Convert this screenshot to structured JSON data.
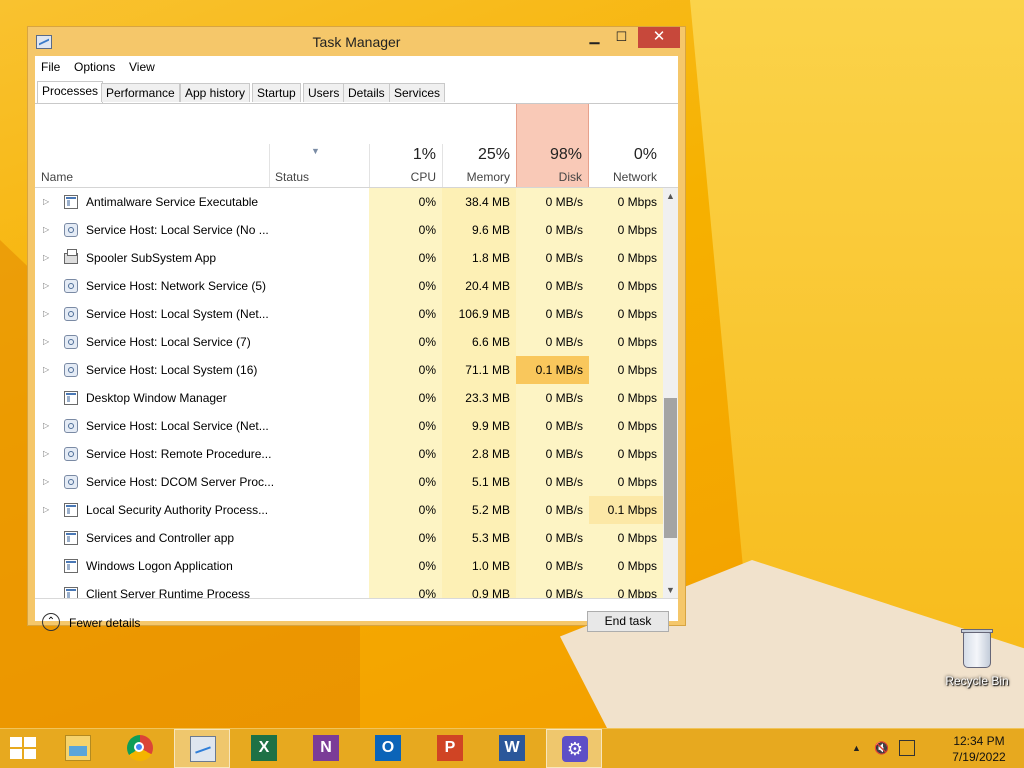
{
  "window": {
    "title": "Task Manager",
    "minimize_glyph": "▁",
    "maximize_glyph": "☐",
    "close_glyph": "✕"
  },
  "menu": [
    "File",
    "Options",
    "View"
  ],
  "tabs": [
    {
      "label": "Processes",
      "active": true
    },
    {
      "label": "Performance"
    },
    {
      "label": "App history"
    },
    {
      "label": "Startup"
    },
    {
      "label": "Users"
    },
    {
      "label": "Details"
    },
    {
      "label": "Services"
    }
  ],
  "columns": {
    "name": "Name",
    "status": "Status",
    "cpu": {
      "pct": "1%",
      "label": "CPU"
    },
    "memory": {
      "pct": "25%",
      "label": "Memory"
    },
    "disk": {
      "pct": "98%",
      "label": "Disk"
    },
    "network": {
      "pct": "0%",
      "label": "Network"
    }
  },
  "colors": {
    "disk_header_bg": "#f9c9b7",
    "heat_high": "#f9c75c",
    "heat_low": "#fdf4c4",
    "close_button": "#c7483b",
    "window_frame": "#f5c76a"
  },
  "processes": [
    {
      "name": "Antimalware Service Executable",
      "icon": "exe-icon",
      "expandable": true,
      "cpu": "0%",
      "memory": "38.4 MB",
      "disk": "0 MB/s",
      "network": "0 Mbps"
    },
    {
      "name": "Service Host: Local Service (No ...",
      "icon": "gear-icon",
      "expandable": true,
      "cpu": "0%",
      "memory": "9.6 MB",
      "disk": "0 MB/s",
      "network": "0 Mbps"
    },
    {
      "name": "Spooler SubSystem App",
      "icon": "printer-icon",
      "expandable": true,
      "cpu": "0%",
      "memory": "1.8 MB",
      "disk": "0 MB/s",
      "network": "0 Mbps"
    },
    {
      "name": "Service Host: Network Service (5)",
      "icon": "gear-icon",
      "expandable": true,
      "cpu": "0%",
      "memory": "20.4 MB",
      "disk": "0 MB/s",
      "network": "0 Mbps"
    },
    {
      "name": "Service Host: Local System (Net...",
      "icon": "gear-icon",
      "expandable": true,
      "cpu": "0%",
      "memory": "106.9 MB",
      "disk": "0 MB/s",
      "network": "0 Mbps"
    },
    {
      "name": "Service Host: Local Service (7)",
      "icon": "gear-icon",
      "expandable": true,
      "cpu": "0%",
      "memory": "6.6 MB",
      "disk": "0 MB/s",
      "network": "0 Mbps"
    },
    {
      "name": "Service Host: Local System (16)",
      "icon": "gear-icon",
      "expandable": true,
      "cpu": "0%",
      "memory": "71.1 MB",
      "disk": "0.1 MB/s",
      "network": "0 Mbps",
      "disk_hot": true
    },
    {
      "name": "Desktop Window Manager",
      "icon": "exe-icon",
      "expandable": false,
      "cpu": "0%",
      "memory": "23.3 MB",
      "disk": "0 MB/s",
      "network": "0 Mbps"
    },
    {
      "name": "Service Host: Local Service (Net...",
      "icon": "gear-icon",
      "expandable": true,
      "cpu": "0%",
      "memory": "9.9 MB",
      "disk": "0 MB/s",
      "network": "0 Mbps"
    },
    {
      "name": "Service Host: Remote Procedure...",
      "icon": "gear-icon",
      "expandable": true,
      "cpu": "0%",
      "memory": "2.8 MB",
      "disk": "0 MB/s",
      "network": "0 Mbps"
    },
    {
      "name": "Service Host: DCOM Server Proc...",
      "icon": "gear-icon",
      "expandable": true,
      "cpu": "0%",
      "memory": "5.1 MB",
      "disk": "0 MB/s",
      "network": "0 Mbps"
    },
    {
      "name": "Local Security Authority Process...",
      "icon": "exe-icon",
      "expandable": true,
      "cpu": "0%",
      "memory": "5.2 MB",
      "disk": "0 MB/s",
      "network": "0.1 Mbps",
      "net_warm": true
    },
    {
      "name": "Services and Controller app",
      "icon": "exe-icon",
      "expandable": false,
      "cpu": "0%",
      "memory": "5.3 MB",
      "disk": "0 MB/s",
      "network": "0 Mbps"
    },
    {
      "name": "Windows Logon Application",
      "icon": "exe-icon",
      "expandable": false,
      "cpu": "0%",
      "memory": "1.0 MB",
      "disk": "0 MB/s",
      "network": "0 Mbps"
    },
    {
      "name": "Client Server Runtime Process",
      "icon": "exe-icon",
      "expandable": false,
      "cpu": "0%",
      "memory": "0.9 MB",
      "disk": "0 MB/s",
      "network": "0 Mbps"
    }
  ],
  "footer": {
    "fewer_details": "Fewer details",
    "end_task": "End task"
  },
  "desktop": {
    "recycle_bin": "Recycle Bin"
  },
  "taskbar": {
    "apps": [
      {
        "name": "file-explorer",
        "icon": "folder-icon"
      },
      {
        "name": "chrome",
        "icon": "chrome-icon"
      },
      {
        "name": "task-manager",
        "icon": "task-manager-icon",
        "active": true
      },
      {
        "name": "excel",
        "icon": "excel-icon",
        "letter": "X"
      },
      {
        "name": "onenote",
        "icon": "onenote-icon",
        "letter": "N"
      },
      {
        "name": "outlook",
        "icon": "outlook-icon",
        "letter": "O"
      },
      {
        "name": "powerpoint",
        "icon": "powerpoint-icon",
        "letter": "P"
      },
      {
        "name": "word",
        "icon": "word-icon",
        "letter": "W"
      },
      {
        "name": "settings",
        "icon": "gear-icon",
        "active": true
      }
    ],
    "time": "12:34 PM",
    "date": "7/19/2022"
  }
}
